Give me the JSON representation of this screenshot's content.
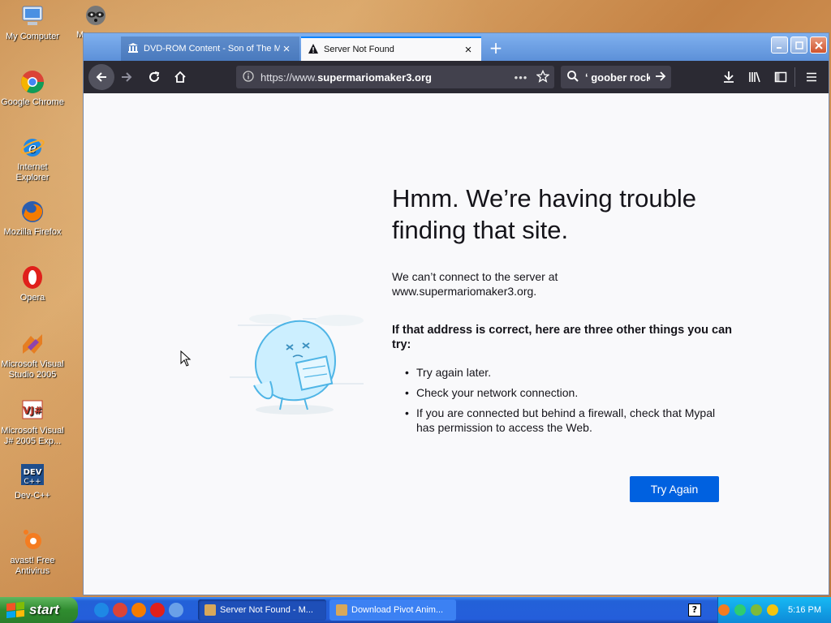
{
  "desktop": {
    "icons": [
      {
        "label": "My Computer",
        "icon": "computer-icon"
      },
      {
        "label": "M",
        "icon": "raccoon-icon"
      },
      {
        "label": "Google Chrome",
        "icon": "chrome-icon"
      },
      {
        "label": "Internet Explorer",
        "icon": "ie-icon"
      },
      {
        "label": "Mozilla Firefox",
        "icon": "firefox-icon"
      },
      {
        "label": "Opera",
        "icon": "opera-icon"
      },
      {
        "label": "Microsoft Visual Studio 2005",
        "icon": "visual-studio-icon"
      },
      {
        "label": "Microsoft Visual J# 2005 Exp...",
        "icon": "visual-j-icon"
      },
      {
        "label": "Dev-C++",
        "icon": "devcpp-icon"
      },
      {
        "label": "avast! Free Antivirus",
        "icon": "avast-icon"
      }
    ]
  },
  "browser": {
    "tabs": [
      {
        "title": "DVD-ROM Content - Son of The M",
        "icon": "museum-icon"
      },
      {
        "title": "Server Not Found",
        "icon": "warning-icon"
      }
    ],
    "new_tab": "+",
    "url_prefix": "https://www.",
    "url_domain": "supermariomaker3.org",
    "url_dots": "•••",
    "search_query": "ʻ goober rock",
    "error": {
      "title": "Hmm. We’re having trouble finding that site.",
      "short": "We can’t connect to the server at www.supermariomaker3.org.",
      "heading": "If that address is correct, here are three other things you can try:",
      "items": [
        "Try again later.",
        "Check your network connection.",
        "If you are connected but behind a firewall, check that Mypal has permission to access the Web."
      ],
      "try_again": "Try Again"
    }
  },
  "taskbar": {
    "start": "start",
    "tasks": [
      {
        "label": "Server Not Found - M...",
        "active": true
      },
      {
        "label": "Download Pivot Anim...",
        "active": false
      }
    ],
    "help": "?",
    "clock": "5:16 PM"
  },
  "colors": {
    "accent": "#0061e0",
    "navbar": "#2b2a33",
    "taskbar": "#245edb",
    "start": "#3c8d3c"
  }
}
